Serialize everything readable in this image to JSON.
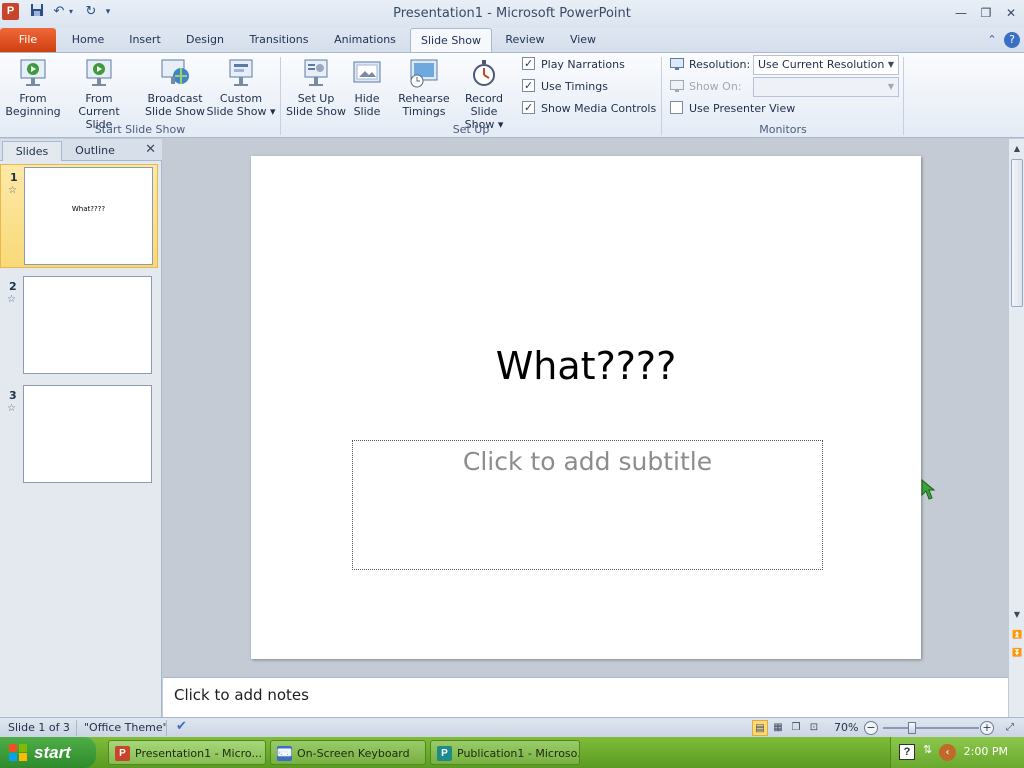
{
  "window": {
    "title": "Presentation1  -  Microsoft PowerPoint",
    "app_icon_letter": "P"
  },
  "tabs": [
    {
      "label": "File",
      "state": "file"
    },
    {
      "label": "Home"
    },
    {
      "label": "Insert"
    },
    {
      "label": "Design"
    },
    {
      "label": "Transitions"
    },
    {
      "label": "Animations"
    },
    {
      "label": "Slide Show",
      "state": "active"
    },
    {
      "label": "Review"
    },
    {
      "label": "View"
    }
  ],
  "ribbon": {
    "start_group": {
      "label": "Start Slide Show",
      "from_beginning": [
        "From",
        "Beginning"
      ],
      "from_current": [
        "From",
        "Current Slide"
      ],
      "broadcast": [
        "Broadcast",
        "Slide Show"
      ],
      "custom": [
        "Custom",
        "Slide Show ▾"
      ]
    },
    "setup_group": {
      "label": "Set Up",
      "setup": [
        "Set Up",
        "Slide Show"
      ],
      "hide": [
        "Hide",
        "Slide"
      ],
      "rehearse": [
        "Rehearse",
        "Timings"
      ],
      "record": [
        "Record Slide",
        "Show ▾"
      ],
      "play_narrations": "Play Narrations",
      "use_timings": "Use Timings",
      "show_media_controls": "Show Media Controls"
    },
    "monitors_group": {
      "label": "Monitors",
      "resolution_label": "Resolution:",
      "resolution_value": "Use Current Resolution",
      "show_on_label": "Show On:",
      "show_on_value": "",
      "presenter_view": "Use Presenter View"
    }
  },
  "left_pane": {
    "tabs": [
      "Slides",
      "Outline"
    ],
    "thumbnails": [
      {
        "num": "1",
        "title": "What????"
      },
      {
        "num": "2",
        "title": ""
      },
      {
        "num": "3",
        "title": ""
      }
    ]
  },
  "slide": {
    "title": "What????",
    "subtitle_placeholder": "Click to add subtitle"
  },
  "notes": {
    "placeholder": "Click to add notes"
  },
  "status": {
    "slide_info": "Slide 1 of 3",
    "theme": "\"Office Theme\"",
    "zoom": "70%"
  },
  "taskbar": {
    "start": "start",
    "tasks": [
      {
        "label": "Presentation1 - Micro...",
        "icon_letter": "P"
      },
      {
        "label": "On-Screen Keyboard",
        "icon_letter": ""
      },
      {
        "label": "Publication1 - Microso...",
        "icon_letter": "P"
      }
    ],
    "clock": "2:00 PM"
  },
  "colors": {
    "file_tab": "#cf3f10",
    "selected_thumb": "#f9d978",
    "taskbar": "#5a9a22"
  }
}
